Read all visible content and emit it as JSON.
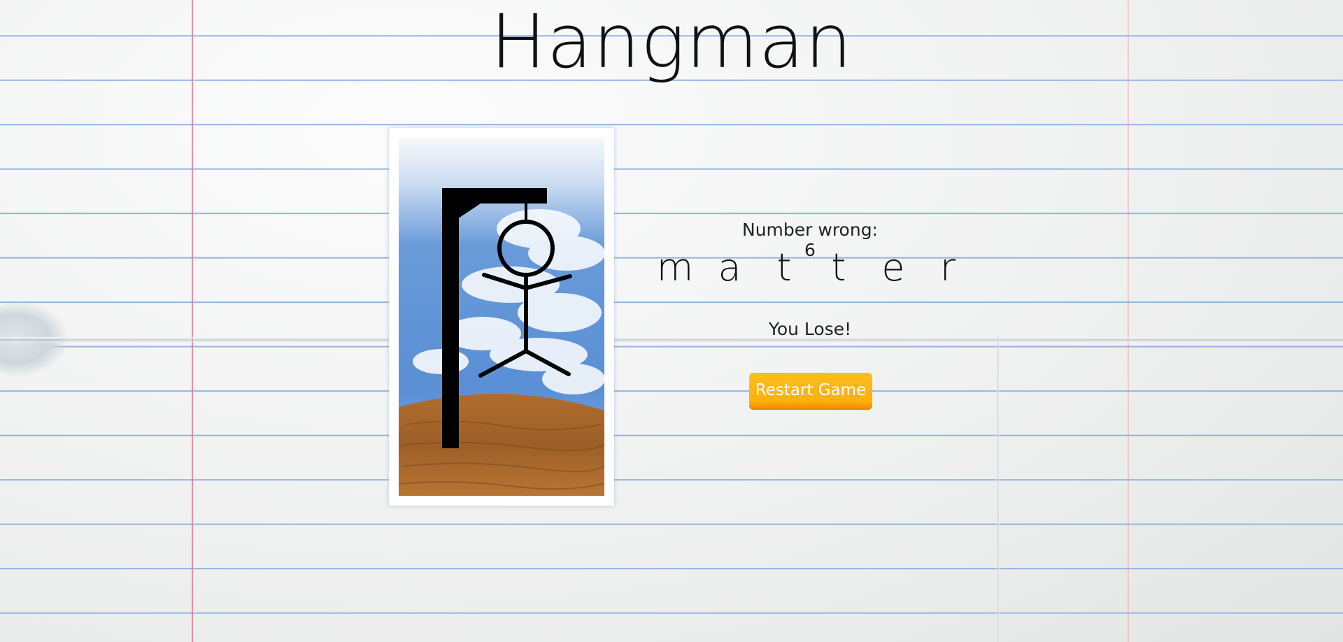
{
  "title": "Hangman",
  "status": {
    "label": "Number wrong:",
    "wrong_count": "6",
    "text": "Number wrong: 6"
  },
  "word": {
    "letters": [
      "m",
      "a",
      "t",
      "t",
      "e",
      "r"
    ]
  },
  "result": "You Lose!",
  "restart_label": "Restart Game",
  "colors": {
    "button": "#ffb00d",
    "button_text": "#ffffff",
    "margin_line": "#e66e82",
    "ruled_line": "#80a8e0"
  },
  "icons": {
    "hangman_scene": "gallows-with-stick-figure"
  }
}
